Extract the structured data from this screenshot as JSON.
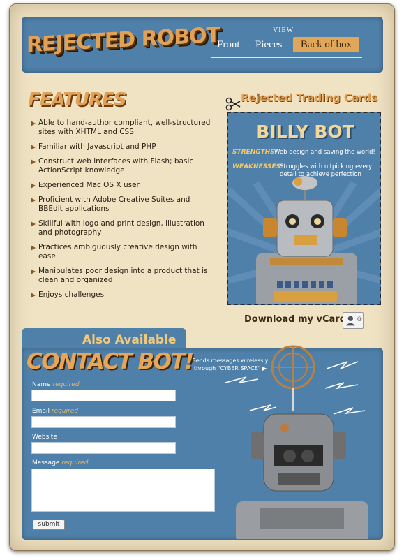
{
  "header": {
    "logo": "REJECTED ROBOT",
    "nav_label": "VIEW",
    "nav": [
      "Front",
      "Pieces",
      "Back of box"
    ]
  },
  "features": {
    "title": "FEATURES",
    "items": [
      "Able to hand-author compliant, well-structured sites with XHTML and CSS",
      "Familiar with Javascript and PHP",
      "Construct web interfaces with Flash; basic ActionScript knowledge",
      "Experienced Mac OS X user",
      "Proficient with Adobe Creative Suites and BBEdit applications",
      "Skillful with logo and print design, illustration and photography",
      "Practices ambiguously creative design with ease",
      "Manipulates poor design into a product that is clean and organized",
      "Enjoys challenges"
    ]
  },
  "trading_card": {
    "section_title": "Rejected Trading Cards",
    "name": "BILLY BOT",
    "strengths_label": "STRENGTHS:",
    "strengths": "Web design and saving the world!",
    "weaknesses_label": "WEAKNESSES:",
    "weaknesses": "Struggles with nitpicking every detail to achieve perfection",
    "download": "Download my vCard"
  },
  "contact": {
    "also": "Also Available",
    "title": "CONTACT BOT!",
    "tagline": "Sends messages wirelessly through \"CYBER SPACE\" ▶",
    "fields": {
      "name_label": "Name",
      "email_label": "Email",
      "website_label": "Website",
      "message_label": "Message",
      "required": "required"
    },
    "submit": "submit"
  },
  "colors": {
    "panel_blue": "#4f80a9",
    "accent_orange": "#e1a257",
    "paper": "#efe3c4"
  }
}
